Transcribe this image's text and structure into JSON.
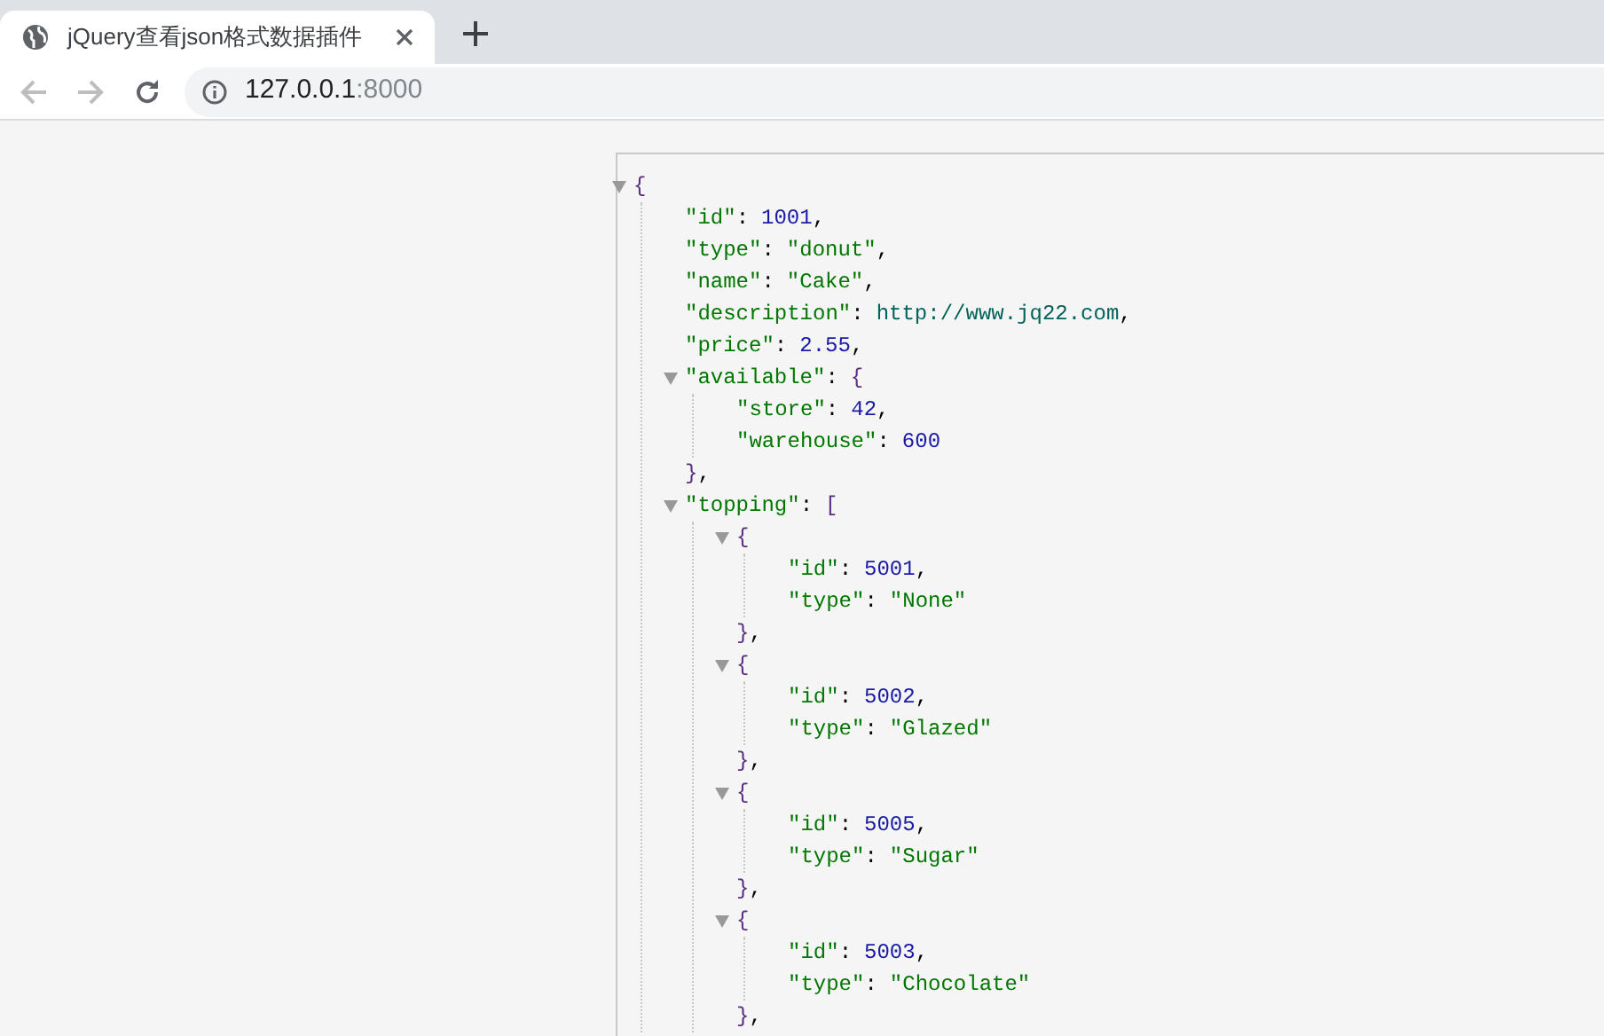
{
  "browser": {
    "tab": {
      "title": "jQuery查看json格式数据插件",
      "selected": true
    },
    "address": {
      "host": "127.0.0.1",
      "port": ":8000"
    }
  },
  "json_viewer": {
    "root": {
      "open": "{",
      "expanded": true,
      "children": [
        {
          "kind": "number",
          "key": "\"id\"",
          "sep": ":",
          "value": "1001",
          "end": ","
        },
        {
          "kind": "string",
          "key": "\"type\"",
          "sep": ":",
          "value": "\"donut\"",
          "end": ","
        },
        {
          "kind": "string",
          "key": "\"name\"",
          "sep": ":",
          "value": "\"Cake\"",
          "end": ","
        },
        {
          "kind": "link",
          "key": "\"description\"",
          "sep": ":",
          "value": "http://www.jq22.com",
          "end": ","
        },
        {
          "kind": "number",
          "key": "\"price\"",
          "sep": ":",
          "value": "2.55",
          "end": ","
        },
        {
          "kind": "object",
          "key": "\"available\"",
          "sep": ":",
          "open": "{",
          "expanded": true,
          "close": "}",
          "end": ",",
          "children": [
            {
              "kind": "number",
              "key": "\"store\"",
              "sep": ":",
              "value": "42",
              "end": ","
            },
            {
              "kind": "number",
              "key": "\"warehouse\"",
              "sep": ":",
              "value": "600"
            }
          ]
        },
        {
          "kind": "object",
          "key": "\"topping\"",
          "sep": ":",
          "open": "[",
          "expanded": true,
          "children": [
            {
              "kind": "object",
              "open": "{",
              "expanded": true,
              "close": "}",
              "end": ",",
              "children": [
                {
                  "kind": "number",
                  "key": "\"id\"",
                  "sep": ":",
                  "value": "5001",
                  "end": ","
                },
                {
                  "kind": "string",
                  "key": "\"type\"",
                  "sep": ":",
                  "value": "\"None\""
                }
              ]
            },
            {
              "kind": "object",
              "open": "{",
              "expanded": true,
              "close": "}",
              "end": ",",
              "children": [
                {
                  "kind": "number",
                  "key": "\"id\"",
                  "sep": ":",
                  "value": "5002",
                  "end": ","
                },
                {
                  "kind": "string",
                  "key": "\"type\"",
                  "sep": ":",
                  "value": "\"Glazed\""
                }
              ]
            },
            {
              "kind": "object",
              "open": "{",
              "expanded": true,
              "close": "}",
              "end": ",",
              "children": [
                {
                  "kind": "number",
                  "key": "\"id\"",
                  "sep": ":",
                  "value": "5005",
                  "end": ","
                },
                {
                  "kind": "string",
                  "key": "\"type\"",
                  "sep": ":",
                  "value": "\"Sugar\""
                }
              ]
            },
            {
              "kind": "object",
              "open": "{",
              "expanded": true,
              "close": "}",
              "end": ",",
              "children": [
                {
                  "kind": "number",
                  "key": "\"id\"",
                  "sep": ":",
                  "value": "5003",
                  "end": ","
                },
                {
                  "kind": "string",
                  "key": "\"type\"",
                  "sep": ":",
                  "value": "\"Chocolate\""
                }
              ]
            }
          ]
        }
      ]
    }
  }
}
